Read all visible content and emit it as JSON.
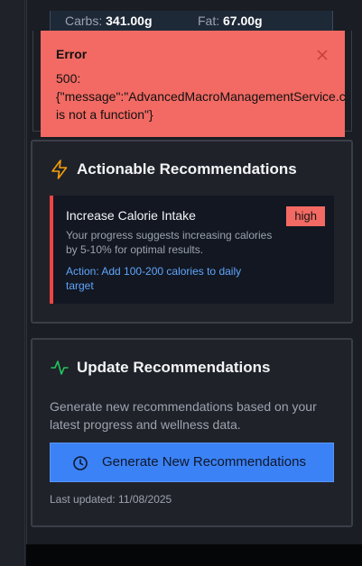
{
  "macros": {
    "carbs_label": "Carbs:",
    "carbs_value": "341.00g",
    "fat_label": "Fat:",
    "fat_value": "67.00g"
  },
  "toast": {
    "title": "Error",
    "message": "500:\n{\"message\":\"AdvancedMacroManagementService.c\nis not a function\"}",
    "close_icon": "close-icon",
    "background": "#f26a63"
  },
  "actionable": {
    "title": "Actionable Recommendations",
    "icon": "lightning-icon",
    "icon_color": "#f59e0b",
    "recommendation": {
      "title": "Increase Calorie Intake",
      "body": "Your progress suggests increasing calories by 5-10% for optimal results.",
      "action": "Action: Add 100-200 calories to daily target",
      "priority": "high",
      "accent_color": "#ef4444"
    }
  },
  "update": {
    "title": "Update Recommendations",
    "icon": "activity-icon",
    "icon_color": "#22c55e",
    "description": "Generate new recommendations based on your latest progress and wellness data.",
    "button_label": "Generate New Recommendations",
    "button_icon": "clock-icon",
    "button_color": "#3b82f6",
    "last_updated": "Last updated: 11/08/2025"
  }
}
